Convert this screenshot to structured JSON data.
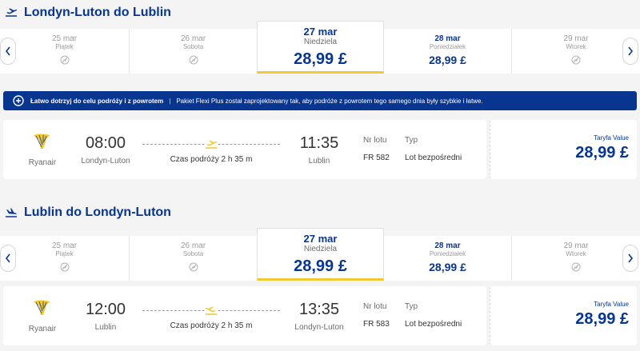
{
  "outbound": {
    "title": "Londyn-Luton do Lublin",
    "dates": [
      {
        "date": "25 mar",
        "day": "Piątek",
        "price": null
      },
      {
        "date": "26 mar",
        "day": "Sobota",
        "price": null
      },
      {
        "date": "27 mar",
        "day": "Niedziela",
        "price": "28,99 £",
        "selected": true
      },
      {
        "date": "28 mar",
        "day": "Poniedziałek",
        "price": "28,99 £"
      },
      {
        "date": "29 mar",
        "day": "Wtorek",
        "price": null
      }
    ],
    "flight": {
      "airline": "Ryanair",
      "dep_time": "08:00",
      "dep_city": "Londyn-Luton",
      "duration": "Czas podróży 2 h 35 m",
      "arr_time": "11:35",
      "arr_city": "Lublin",
      "flight_no_label": "Nr lotu",
      "flight_no": "FR 582",
      "type_label": "Typ",
      "type": "Lot bezpośredni",
      "fare_label": "Taryfa Value",
      "fare_price": "28,99 £"
    }
  },
  "banner": {
    "strong": "Łatwo dotrzyj do celu podróży i z powrotem",
    "separator": "|",
    "text": "Pakiet Flexi Plus został zaprojektowany tak, aby podróże z powrotem tego samego dnia były szybkie i łatwe."
  },
  "inbound": {
    "title": "Lublin do Londyn-Luton",
    "dates": [
      {
        "date": "25 mar",
        "day": "Piątek",
        "price": null
      },
      {
        "date": "26 mar",
        "day": "Sobota",
        "price": null
      },
      {
        "date": "27 mar",
        "day": "Niedziela",
        "price": "28,99 £",
        "selected": true
      },
      {
        "date": "28 mar",
        "day": "Poniedziałek",
        "price": "28,99 £"
      },
      {
        "date": "29 mar",
        "day": "Wtorek",
        "price": null
      }
    ],
    "flight": {
      "airline": "Ryanair",
      "dep_time": "12:00",
      "dep_city": "Lublin",
      "duration": "Czas podróży 2 h 35 m",
      "arr_time": "13:35",
      "arr_city": "Londyn-Luton",
      "flight_no_label": "Nr lotu",
      "flight_no": "FR 583",
      "type_label": "Typ",
      "type": "Lot bezpośredni",
      "fare_label": "Taryfa Value",
      "fare_price": "28,99 £"
    }
  },
  "colors": {
    "brand_blue": "#073590",
    "accent_yellow": "#f1c933",
    "background": "#f4f4f4"
  },
  "icons": {
    "section_icon": "plane-icon",
    "no_flight_icon": "no-flight-icon",
    "prev": "chevron-left-icon",
    "next": "chevron-right-icon",
    "banner_icon": "plus-circle-icon",
    "airline_logo": "ryanair-harp-logo"
  }
}
